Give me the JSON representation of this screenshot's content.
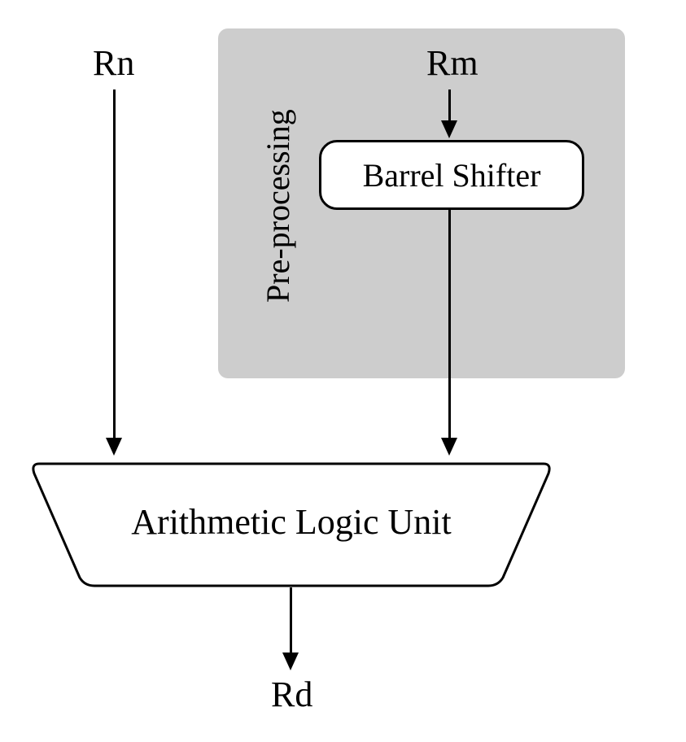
{
  "labels": {
    "rn": "Rn",
    "rm": "Rm",
    "rd": "Rd",
    "preprocessing": "Pre-processing",
    "barrel_shifter": "Barrel Shifter",
    "alu": "Arithmetic Logic Unit"
  },
  "colors": {
    "background": "#ffffff",
    "preprocess_bg": "#cdcdcd",
    "line": "#000000"
  }
}
